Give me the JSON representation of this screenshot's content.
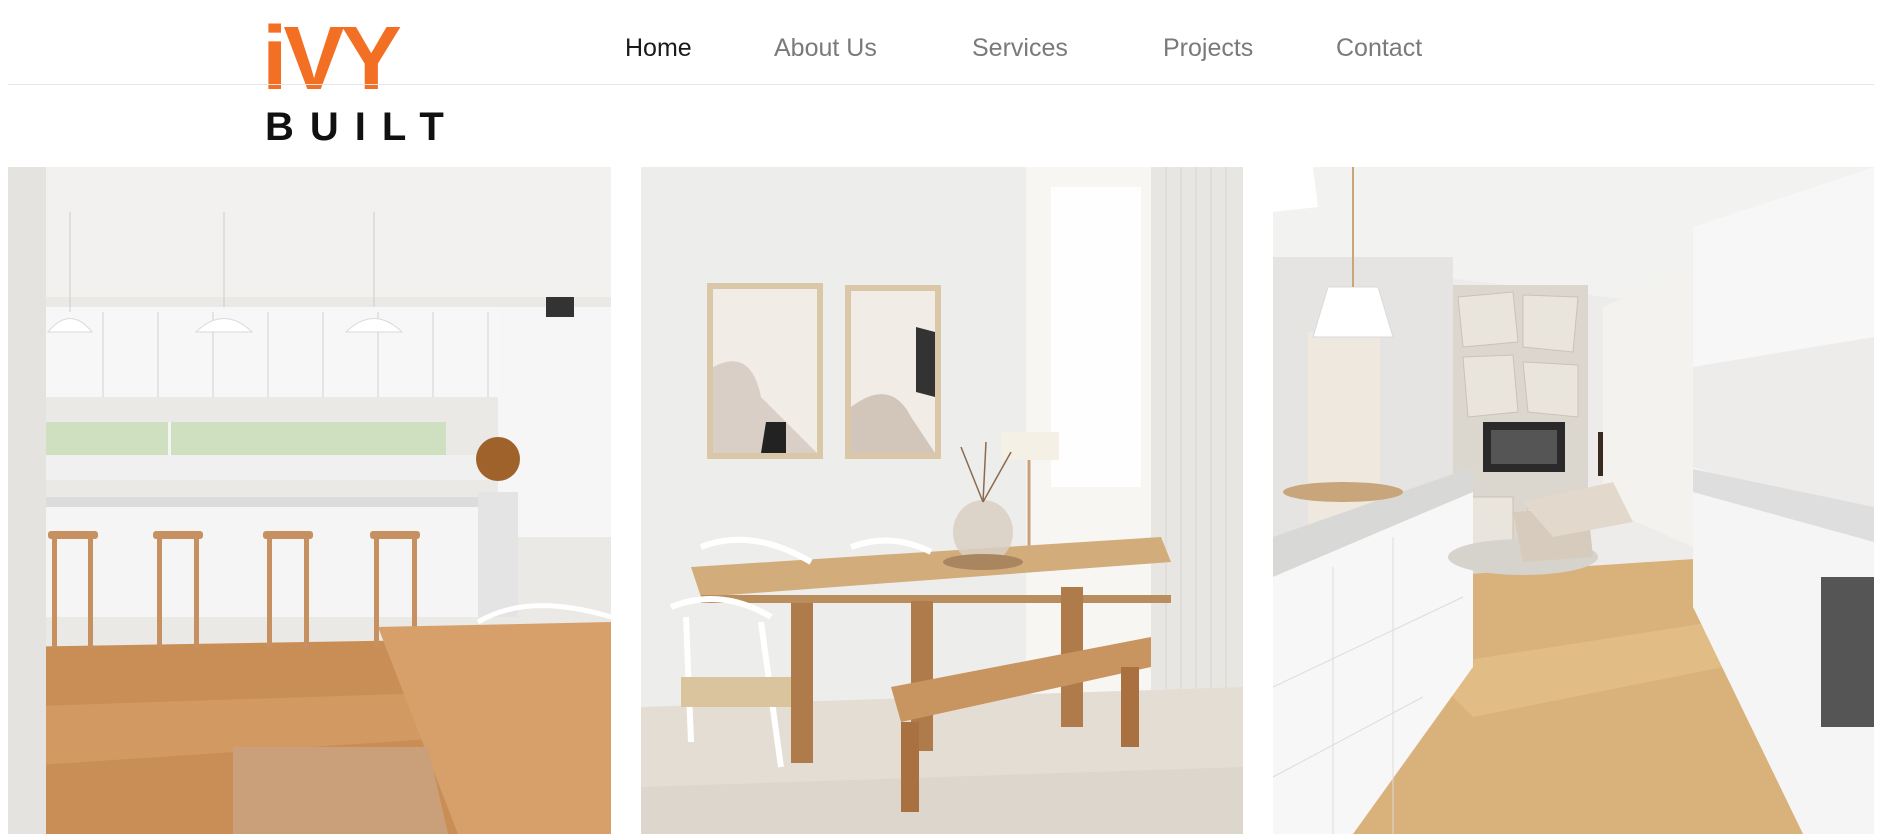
{
  "brand": {
    "logo_top": "iVY",
    "logo_bottom": "BUILT",
    "accent_color": "#f26f23"
  },
  "nav": {
    "items": [
      {
        "label": "Home",
        "active": true
      },
      {
        "label": "About Us",
        "active": false
      },
      {
        "label": "Services",
        "active": false
      },
      {
        "label": "Projects",
        "active": false
      },
      {
        "label": "Contact",
        "active": false
      }
    ]
  },
  "gallery": {
    "images": [
      {
        "subject": "kitchen-with-island-and-stools"
      },
      {
        "subject": "dining-room-with-table-and-bench"
      },
      {
        "subject": "open-plan-living-with-fireplace"
      }
    ]
  }
}
